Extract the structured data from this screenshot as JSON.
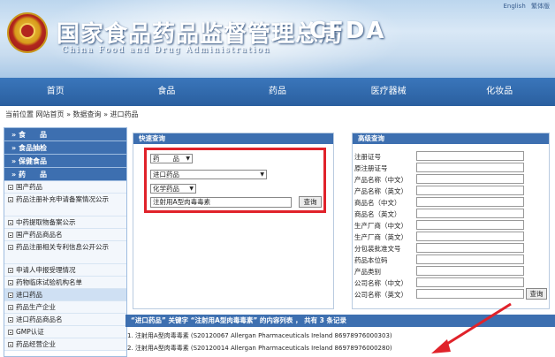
{
  "header": {
    "top_links": [
      "English",
      "繁体版"
    ],
    "title_cn": "国家食品药品监督管理总局",
    "title_en": "China Food and Drug Administration",
    "logo_text": "CFDA"
  },
  "nav": [
    "首页",
    "食品",
    "药品",
    "医疗器械",
    "化妆品"
  ],
  "breadcrumb": "当前位置  网站首页 » 数据查询 » 进口药品",
  "sidebar": {
    "headers": [
      "» 食　　品",
      "» 食品抽检",
      "» 保健食品",
      "» 药　　品"
    ],
    "items": [
      "国产药品",
      "药品注册补充申请备案情况公示",
      "中药提取物备案公示",
      "国产药品商品名",
      "药品注册相关专利信息公开公示",
      "申请人申报受理情况",
      "药物临床试验机构名单",
      "进口药品",
      "药品生产企业",
      "进口药品商品名",
      "GMP认证",
      "药品经营企业"
    ],
    "active": "进口药品"
  },
  "quick_search": {
    "title": "快速查询",
    "category_select": "药　　品",
    "subcategory_select": "进口药品",
    "field_select": "化学药品",
    "query_value": "注射用A型肉毒毒素",
    "button": "查询"
  },
  "advanced_search": {
    "title": "高级查询",
    "fields": [
      "注册证号",
      "原注册证号",
      "产品名称（中文）",
      "产品名称（英文）",
      "商品名（中文）",
      "商品名（英文）",
      "生产厂商（中文）",
      "生产厂商（英文）",
      "分包装批准文号",
      "药品本位码",
      "产品类别",
      "公司名称（中文）",
      "公司名称（英文）"
    ],
    "button": "查询"
  },
  "results": {
    "header": "“进口药品” 关键字 “注射用A型肉毒毒素” 的内容列表 ，  共有 3 条记录",
    "items": [
      "1. 注射用A型肉毒毒素  (S20120067 Allergan Pharmaceuticals Ireland 86978976000303)",
      "2. 注射用A型肉毒毒素  (S20120014 Allergan Pharmaceuticals Ireland 86978976000280)"
    ]
  },
  "colors": {
    "nav_blue": "#2a5f9f",
    "panel_head": "#3d6fb0",
    "highlight_red": "#e0222a"
  }
}
